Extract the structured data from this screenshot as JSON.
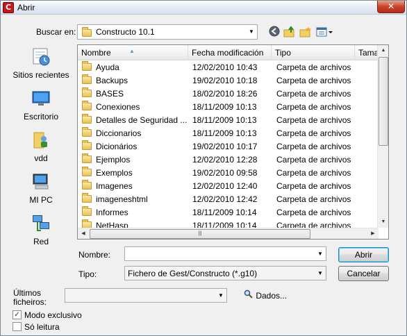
{
  "window": {
    "title": "Abrir",
    "app_icon_letter": "C",
    "close_glyph": "✕"
  },
  "lookin": {
    "label": "Buscar en:",
    "value": "Constructo 10.1"
  },
  "toolbar": {
    "back_icon": "back-icon",
    "up_icon": "up-folder-icon",
    "new_folder_icon": "new-folder-icon",
    "views_icon": "views-menu-icon"
  },
  "places": [
    {
      "label": "Sitios recientes",
      "icon": "recent-places-icon"
    },
    {
      "label": "Escritorio",
      "icon": "desktop-icon"
    },
    {
      "label": "vdd",
      "icon": "user-folder-icon"
    },
    {
      "label": "MI PC",
      "icon": "computer-icon"
    },
    {
      "label": "Red",
      "icon": "network-icon"
    }
  ],
  "list": {
    "columns": [
      "Nombre",
      "Fecha modificación",
      "Tipo",
      "Tama"
    ],
    "rows": [
      {
        "name": "Ayuda",
        "date": "12/02/2010 10:43",
        "type": "Carpeta de archivos"
      },
      {
        "name": "Backups",
        "date": "19/02/2010 10:18",
        "type": "Carpeta de archivos"
      },
      {
        "name": "BASES",
        "date": "18/02/2010 18:26",
        "type": "Carpeta de archivos"
      },
      {
        "name": "Conexiones",
        "date": "18/11/2009 10:13",
        "type": "Carpeta de archivos"
      },
      {
        "name": "Detalles de Seguridad ...",
        "date": "18/11/2009 10:13",
        "type": "Carpeta de archivos"
      },
      {
        "name": "Diccionarios",
        "date": "18/11/2009 10:13",
        "type": "Carpeta de archivos"
      },
      {
        "name": "Dicionários",
        "date": "19/02/2010 10:17",
        "type": "Carpeta de archivos"
      },
      {
        "name": "Ejemplos",
        "date": "12/02/2010 12:28",
        "type": "Carpeta de archivos"
      },
      {
        "name": "Exemplos",
        "date": "19/02/2010 09:58",
        "type": "Carpeta de archivos"
      },
      {
        "name": "Imagenes",
        "date": "12/02/2010 12:40",
        "type": "Carpeta de archivos"
      },
      {
        "name": "imageneshtml",
        "date": "12/02/2010 12:42",
        "type": "Carpeta de archivos"
      },
      {
        "name": "Informes",
        "date": "18/11/2009 10:14",
        "type": "Carpeta de archivos"
      },
      {
        "name": "NetHasp",
        "date": "18/11/2009 10:14",
        "type": "Carpeta de archivos"
      }
    ]
  },
  "filename": {
    "label": "Nombre:",
    "value": ""
  },
  "filetype": {
    "label": "Tipo:",
    "value": "Fichero de Gest/Constructo (*.g10)"
  },
  "buttons": {
    "open": "Abrir",
    "cancel": "Cancelar"
  },
  "recent": {
    "label_line1": "Últimos",
    "label_line2": "ficheiros:",
    "value": ""
  },
  "details": {
    "label": "Dados..."
  },
  "options": {
    "exclusive": {
      "label": "Modo exclusivo",
      "checked": true,
      "mark": "✓"
    },
    "readonly": {
      "label": "Só leitura",
      "checked": false
    }
  }
}
